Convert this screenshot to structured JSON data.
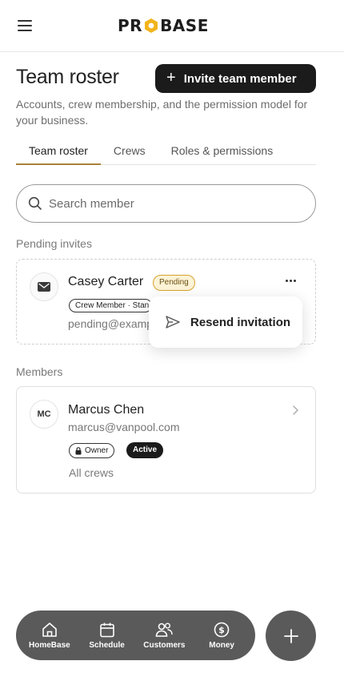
{
  "header": {
    "logo": {
      "text_before": "PR",
      "text_after": "BASE",
      "accent": "#f2b41b"
    }
  },
  "page": {
    "title": "Team roster",
    "subtitle": "Accounts, crew membership, and the permission model for your business.",
    "invite_label": "Invite team member"
  },
  "tabs": [
    {
      "label": "Team roster",
      "active": true
    },
    {
      "label": "Crews",
      "active": false
    },
    {
      "label": "Roles & permissions",
      "active": false
    }
  ],
  "search": {
    "placeholder": "Search member",
    "value": ""
  },
  "pending": {
    "section_label": "Pending invites",
    "invite": {
      "name": "Casey Carter",
      "status": "Pending",
      "role": "Crew Member · Standard",
      "email": "pending@example.com",
      "icon": "mail-icon"
    },
    "menu": {
      "action_label": "Resend invitation",
      "icon": "send-icon"
    }
  },
  "members": {
    "section_label": "Members",
    "items": [
      {
        "initials": "MC",
        "name": "Marcus Chen",
        "email": "marcus@vanpool.com",
        "role": "Owner",
        "status": "Active",
        "crews": "All crews"
      }
    ]
  },
  "bottom_nav": {
    "items": [
      {
        "label": "HomeBase",
        "icon": "home-icon"
      },
      {
        "label": "Schedule",
        "icon": "calendar-icon"
      },
      {
        "label": "Customers",
        "icon": "customers-icon"
      },
      {
        "label": "Money",
        "icon": "dollar-icon"
      }
    ],
    "fab_icon": "plus-icon"
  },
  "colors": {
    "tab_underline": "#a8823a",
    "pending_badge_border": "#d6a22f",
    "pending_badge_bg": "#fdf3d6",
    "nav_bg": "#5a5a5a",
    "primary_button": "#1b1b1b"
  }
}
